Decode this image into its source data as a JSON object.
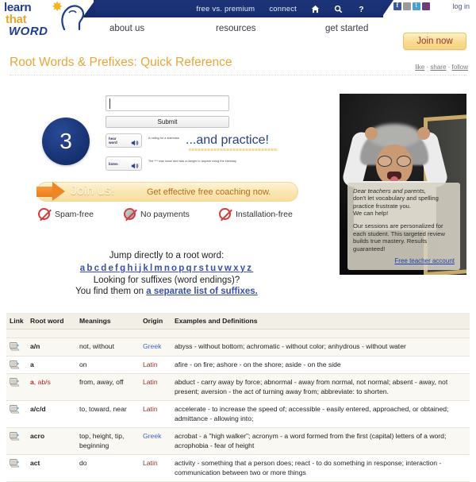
{
  "topbar": {
    "links": [
      {
        "label": "free vs. premium",
        "name": "nav-free-vs-premium"
      },
      {
        "label": "connect",
        "name": "nav-connect"
      }
    ],
    "icons": [
      "home-icon",
      "search-icon",
      "help-icon"
    ],
    "social": [
      "facebook-icon",
      "pinterest-icon",
      "twitter-icon",
      "email-icon"
    ],
    "login_label": "log in"
  },
  "logo": {
    "line1": "learn",
    "line2": "that",
    "line3": "WORD"
  },
  "mainnav": {
    "items": [
      {
        "label": "about us",
        "name": "nav-about-us"
      },
      {
        "label": "resources",
        "name": "nav-resources"
      },
      {
        "label": "get started",
        "name": "nav-get-started"
      }
    ],
    "join_now_label": "Join now"
  },
  "page": {
    "title": "Root Words & Prefixes: Quick Reference",
    "like": "like",
    "sep1": "·",
    "share": "share",
    "sep2": "·",
    "follow": "follow"
  },
  "promo": {
    "step_number": "3",
    "input_value": "",
    "input_placeholder": "",
    "submit_label": "Submit",
    "hear_word_label_line1": "hear",
    "hear_word_label_line2": "word",
    "listen_label": "listen",
    "hint_row1": "A railing for a staircase.",
    "hint_row2": "The *** was loose and was a danger to anyone using the stairway.",
    "practice_text": "...and practice!",
    "join_us_label": "Join us!",
    "join_us_sub": "Get effective free coaching now.",
    "benefits": [
      {
        "label": "Spam-free",
        "icon": "no-spam-icon"
      },
      {
        "label": "No payments",
        "icon": "no-payments-icon"
      },
      {
        "label": "Installation-free",
        "icon": "no-install-icon"
      }
    ]
  },
  "ad": {
    "line1": "Dear teachers and parents,",
    "line2": "don't let vocabulary and spelling practice frustrate you.",
    "line3": "We can help!",
    "para2": "Our sessions are personalized for each student. This targeted review builds true mastery. Results guaranteed!",
    "link": "Free teacher account"
  },
  "jump": {
    "heading": "Jump directly to a root word:",
    "letters": [
      "a",
      "b",
      "c",
      "d",
      "e",
      "f",
      "g",
      "h",
      "i",
      "j",
      "k",
      "l",
      "m",
      "n",
      "o",
      "p",
      "q",
      "r",
      "s",
      "t",
      "u",
      "v",
      "w",
      "x",
      "y",
      "z"
    ],
    "suffix_question": "Looking for suffixes (word endings)?",
    "suffix_prefix": "You find them on",
    "suffix_link": "a separate list of suffixes."
  },
  "table": {
    "headers": [
      "Link",
      "Root word",
      "Meanings",
      "Origin",
      "Examples and Definitions"
    ],
    "rows": [
      {
        "root": "a/n",
        "root_style": "bold",
        "meanings": "not, without",
        "origin": "Greek",
        "examples": "abyss - without bottom; achromatic - without color; anhydrous - without water"
      },
      {
        "root": "a",
        "root_style": "bold",
        "meanings": "on",
        "origin": "Latin",
        "examples": "afire - on fire; ashore - on the shore; aside - on the side"
      },
      {
        "root": "a, ab/s",
        "root_style": "red",
        "meanings": "from, away, off",
        "origin": "Latin",
        "examples": "abduct - carry away by force; abnormal - away from normal, not normal; absent - away, not present; aversion - the act of turning away from; abbreviate: to shorten."
      },
      {
        "root": "a/c/d",
        "root_style": "bold",
        "meanings": "to, toward, near",
        "origin": "Latin",
        "examples": "accelerate - to increase the speed of; accessible - easily entered, approached, or obtained; admittance - allowing into;"
      },
      {
        "root": "acro",
        "root_style": "bold",
        "meanings": "top, height, tip, beginning",
        "origin": "Greek",
        "examples": "acrobat - a \"high walker\"; acronym - a word formed from the first (capital) letters of a word; acrophobia - fear of height"
      },
      {
        "root": "act",
        "root_style": "bold",
        "meanings": "do",
        "origin": "Latin",
        "examples": "activity - something that a person does; react - to do something in response; interaction - communication between two or more things"
      }
    ]
  },
  "colors": {
    "navy": "#1b3276",
    "title_gold": "#e8a63a",
    "link_blue": "#3a4fa8",
    "latin_red": "#9b2f2f",
    "greek_blue": "#3f5fd0",
    "join_gold": "#f5d37c",
    "arrow_orange": "#ef8526"
  }
}
